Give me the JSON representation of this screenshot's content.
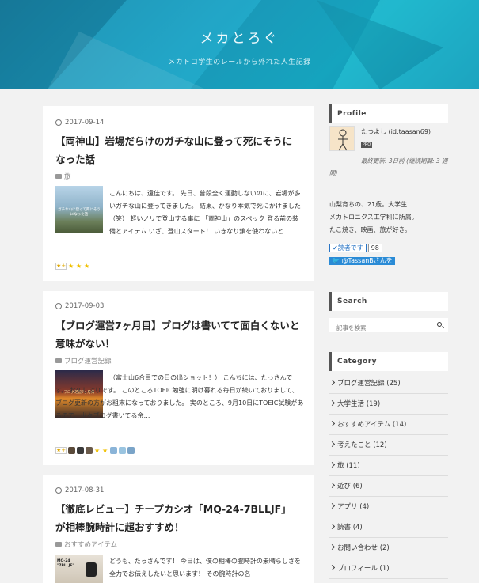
{
  "site": {
    "title": "メカとろぐ",
    "description": "メカトロ学生のレールから外れた人生記録"
  },
  "posts": [
    {
      "date": "2017-09-14",
      "title": "【両神山】岩場だらけのガチな山に登って死にそうになった話",
      "category": "旅",
      "thumb_caption": "ガチな山に登って死にそうになった話",
      "excerpt": "こんにちは、遠佳です。 先日、普段全く運動しないのに、岩場が多いガチな山に登ってきました。 結果、かなり本気で死にかけました（笑） 軽いノリで登山する事に 「両神山」のスペック 登る前の装備とアイテム いざ、登山スタート！ いきなり鎖を使わないと…",
      "star_count": 3
    },
    {
      "date": "2017-09-03",
      "title": "【ブログ運営7ヶ月目】ブログは書いてて面白くないと意味がない！",
      "category": "ブログ運営記録",
      "thumb_caption": "ブログ運営7ヶ月目",
      "excerpt": "（富士山6合目での日の出ショット！） こんちには、たっさんです。 お久しぶりです。 このところTOEIC勉強に明け暮れる毎日が続いておりまして、ブログ更新の方がお粗末になっておりました。 実のところ、9月10日にTOEIC試験があるので、少々ブログ書いてる余…",
      "star_count": 8
    },
    {
      "date": "2017-08-31",
      "title": "【徹底レビュー】チープカシオ「MQ-24-7BLLJF」が相棒腕時計に超おすすめ！",
      "category": "おすすめアイテム",
      "thumb_caption": "MQ-24 \"7BLLJF\"",
      "excerpt": "どうも、たっさんです！ 今日は、僕の相棒の腕時計の素晴らしさを全力でお伝えしたいと思います！ その腕時計の名"
    }
  ],
  "sidebar": {
    "profile_heading": "Profile",
    "user_name": "たつよし (id:taasan69)",
    "pro_badge": "PRO",
    "last_update": "最終更新: 3日前 (継続期間: 3 週間)",
    "bio_line1": "山梨育ちの、21歳。大学生",
    "bio_line2": "メカトロニクス工学科に所属。",
    "bio_line3": "たこ焼き、映画、旅が好き。",
    "reader_button": "✔読者です",
    "reader_count": "98",
    "twitter_button": "@TassanBさんを",
    "search_heading": "Search",
    "search_placeholder": "記事を検索",
    "category_heading": "Category",
    "categories": [
      "ブログ運営記録 (25)",
      "大学生活 (19)",
      "おすすめアイテム (14)",
      "考えたこと (12)",
      "旅 (11)",
      "遊び (6)",
      "アプリ (4)",
      "読書 (4)",
      "お問い合わせ (2)",
      "プロフィール (1)"
    ]
  },
  "colors": {
    "header_accent": "#1f9fc0",
    "twitter_blue": "#2a8bd6",
    "star": "#f0c000"
  }
}
